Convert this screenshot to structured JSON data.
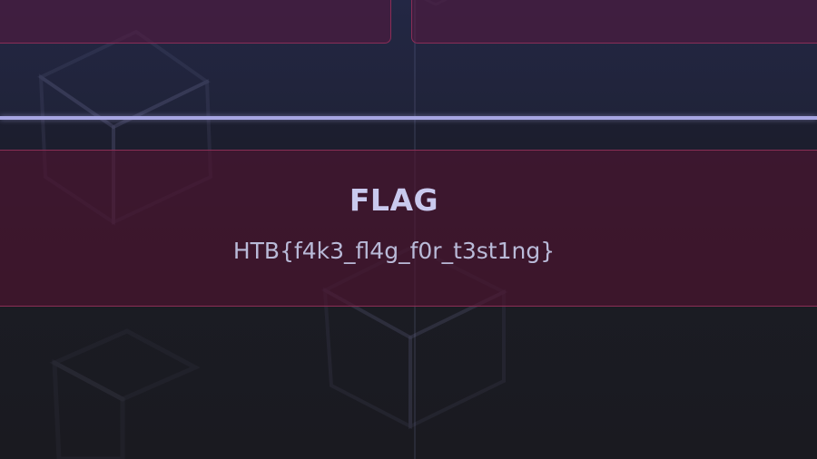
{
  "flag": {
    "title": "FLAG",
    "value": "HTB{f4k3_fl4g_f0r_t3st1ng}"
  },
  "colors": {
    "panel_border": "#8b2e55",
    "panel_fill": "#50142f",
    "divider": "#a7a6e2",
    "title_text": "#c9c9ee",
    "value_text": "#b9bad8"
  },
  "decorations": {
    "background_icon": "cube-outline-icon"
  }
}
